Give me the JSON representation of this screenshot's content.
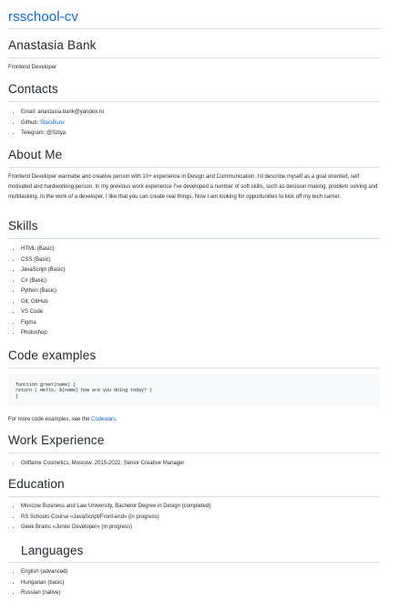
{
  "site_title": "rsschool-cv",
  "name": "Anastasia Bank",
  "role": "Frontend Developer",
  "contacts": {
    "heading": "Contacts",
    "email_label": "Email: ",
    "email": "anastasia.bank@yandex.ru",
    "github_label": "Github: ",
    "github": "StaciBunx",
    "telegram_label": "Telegram: ",
    "telegram": "@Sztya"
  },
  "about": {
    "heading": "About Me",
    "text": "Frontend Developer wannabe and creative person with 10+ experience in Design and Communication. I'd describe myself as a goal oriented, self motivated and hardworking person. In my previous work experience I've developed a number of soft skills, such as decision making, problem solving and multitasking. In the work of a developer, I like that you can create real things. Now I am looking for opportunities to kick off my tech carrier."
  },
  "skills": {
    "heading": "Skills",
    "items": [
      "HTML (Basic)",
      "CSS (Basic)",
      "JavaScript (Basic)",
      "C# (Basic)",
      "Python (Basic)",
      "Git, GitHub",
      "VS Code",
      "Figma",
      "Photoshop"
    ]
  },
  "code_examples": {
    "heading": "Code examples",
    "code": "function greet(name) {\nreturn ( Hello, ${name} how are you doing today? )\n}",
    "note_prefix": "For more code examples, see the ",
    "note_link": "Codewars",
    "note_suffix": "."
  },
  "work": {
    "heading": "Work Experience",
    "items": [
      "Oriflame Cosmetics, Moscow. 2015-2022. Senior Creative Manager"
    ]
  },
  "education": {
    "heading": "Education",
    "items": [
      "Moscow Business and Law University, Bachelor Degree in Design (completed)",
      "RS Schools Course «JavaScript/Front-end» (in progress)",
      "Geek Brains «Junior Developer» (in progress)"
    ]
  },
  "languages": {
    "heading": "Languages",
    "items": [
      "English (advanced)",
      "Hungarian (basic)",
      "Russian (native)"
    ]
  }
}
